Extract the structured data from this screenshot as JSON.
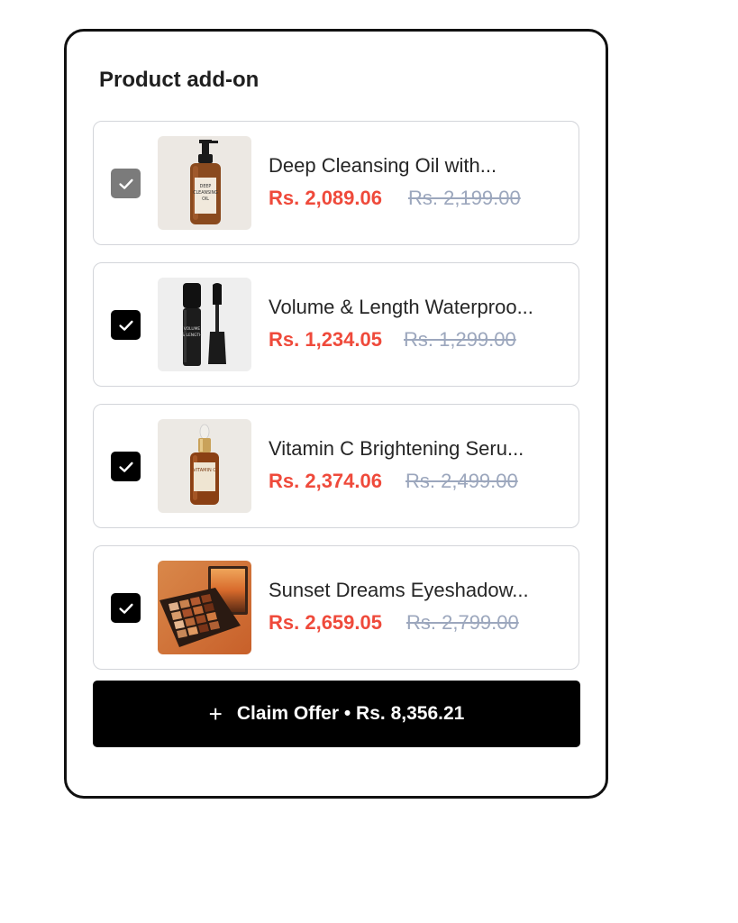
{
  "widget": {
    "title": "Product add-on",
    "claim_plus": "+",
    "claim_label": "Claim Offer • Rs. 8,356.21"
  },
  "items": [
    {
      "name": "Deep Cleansing Oil with...",
      "price": "Rs. 2,089.06",
      "old_price": "Rs. 2,199.00",
      "checked": true,
      "disabled": true,
      "image": "cleansing-oil-bottle-image",
      "label_lines": [
        "DEEP",
        "CLEANSING",
        "OIL"
      ]
    },
    {
      "name": "Volume & Length Waterproo...",
      "price": "Rs. 1,234.05",
      "old_price": "Rs. 1,299.00",
      "checked": true,
      "disabled": false,
      "image": "mascara-image",
      "label_lines": [
        "VOLUME",
        "& LENGTH"
      ]
    },
    {
      "name": "Vitamin C Brightening Seru...",
      "price": "Rs. 2,374.06",
      "old_price": "Rs. 2,499.00",
      "checked": true,
      "disabled": false,
      "image": "serum-dropper-bottle-image",
      "label_lines": [
        "VITAMIN C"
      ]
    },
    {
      "name": "Sunset Dreams Eyeshadow...",
      "price": "Rs. 2,659.05",
      "old_price": "Rs. 2,799.00",
      "checked": true,
      "disabled": false,
      "image": "eyeshadow-palette-image"
    }
  ],
  "colors": {
    "sale_price": "#ef4a3b",
    "old_price": "#9ca7bd",
    "checkbox_checked": "#000000",
    "checkbox_disabled": "#7b7b7b",
    "button_bg": "#000000"
  }
}
